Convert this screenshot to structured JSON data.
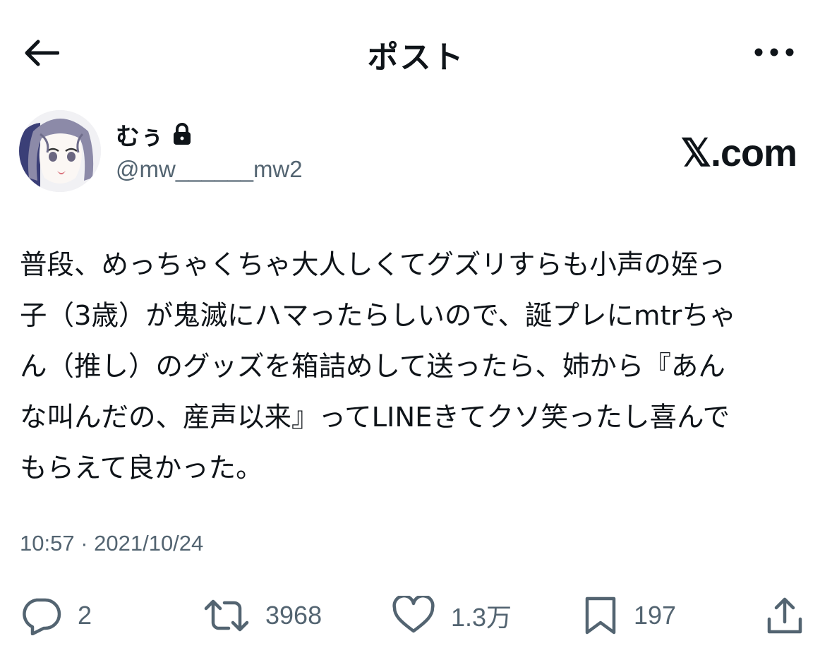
{
  "header": {
    "title": "ポスト",
    "back_icon": "arrow-left-icon",
    "more_icon": "more-horizontal-icon"
  },
  "author": {
    "display_name": "むぅ",
    "handle": "@mw______mw2",
    "protected_icon": "lock-icon"
  },
  "brand": "𝕏.com",
  "tweet": {
    "text": "普段、めっちゃくちゃ大人しくてグズリすらも小声の姪っ\n子（3歳）が鬼滅にハマったらしいので、誕プレにmtrちゃ\nん（推し）のグッズを箱詰めして送ったら、姉から『あん\nな叫んだの、産声以来』ってLINEきてクソ笑ったし喜んで\nもらえて良かった。",
    "timestamp": "10:57 · 2021/10/24"
  },
  "actions": {
    "reply": {
      "icon": "reply-icon",
      "count": "2"
    },
    "retweet": {
      "icon": "retweet-icon",
      "count": "3968"
    },
    "like": {
      "icon": "heart-icon",
      "count": "1.3万"
    },
    "bookmark": {
      "icon": "bookmark-icon",
      "count": "197"
    },
    "share": {
      "icon": "share-icon"
    }
  },
  "colors": {
    "text": "#0f1419",
    "secondary": "#536471",
    "background": "#ffffff"
  }
}
